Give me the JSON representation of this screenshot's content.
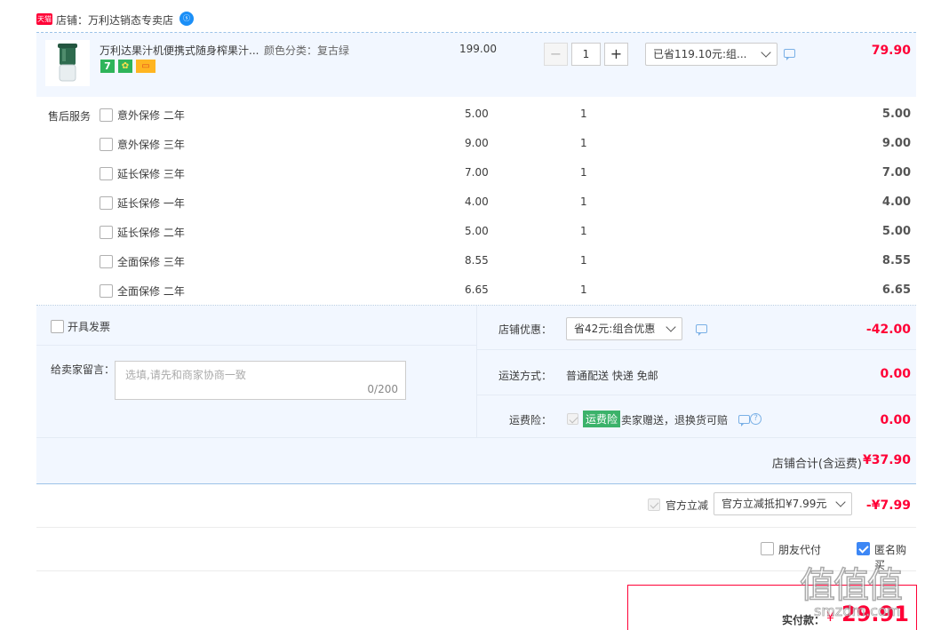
{
  "shop": {
    "badge": "天猫",
    "label": "店铺：",
    "name": "万利达销态专卖店",
    "chat_badge": "ⓢ"
  },
  "product": {
    "name": "万利达果汁机便携式随身榨果汁...",
    "color_label": "颜色分类：复古绿",
    "price": "199.00",
    "quantity": "1",
    "minus": "−",
    "plus": "+",
    "discount_select": "已省119.10元:组...",
    "total": "79.90",
    "badges": [
      "7",
      "✿",
      "▭"
    ]
  },
  "after_sales": {
    "label": "售后服务",
    "items": [
      {
        "name": "意外保修 二年",
        "price": "5.00",
        "qty": "1",
        "total": "5.00"
      },
      {
        "name": "意外保修 三年",
        "price": "9.00",
        "qty": "1",
        "total": "9.00"
      },
      {
        "name": "延长保修 三年",
        "price": "7.00",
        "qty": "1",
        "total": "7.00"
      },
      {
        "name": "延长保修 一年",
        "price": "4.00",
        "qty": "1",
        "total": "4.00"
      },
      {
        "name": "延长保修 二年",
        "price": "5.00",
        "qty": "1",
        "total": "5.00"
      },
      {
        "name": "全面保修 三年",
        "price": "8.55",
        "qty": "1",
        "total": "8.55"
      },
      {
        "name": "全面保修 二年",
        "price": "6.65",
        "qty": "1",
        "total": "6.65"
      }
    ]
  },
  "invoice": {
    "label": "开具发票"
  },
  "message": {
    "label": "给卖家留言：",
    "placeholder": "选填,请先和商家协商一致",
    "counter": "0/200"
  },
  "shop_discount": {
    "label": "店铺优惠：",
    "select": "省42元:组合优惠",
    "amount": "-42.00"
  },
  "shipping": {
    "label": "运送方式：",
    "value": "普通配送 快递 免邮",
    "amount": "0.00"
  },
  "insurance": {
    "label": "运费险：",
    "tag": "运费险",
    "text": "卖家赠送，退换货可赔",
    "amount": "0.00",
    "help": "?"
  },
  "shop_total": {
    "label": "店铺合计(含运费)",
    "amount": "¥37.90"
  },
  "official": {
    "label": "官方立减",
    "select": "官方立减抵扣¥7.99元",
    "amount": "-¥7.99"
  },
  "options": {
    "friend_pay": "朋友代付",
    "anonymous": "匿名购买"
  },
  "payable": {
    "label": "实付款：",
    "currency": "¥",
    "amount": "29.91"
  },
  "watermark": {
    "text": "值值值",
    "sub": "smzdm.com"
  },
  "colors": {
    "accent": "#ff0036",
    "panel": "#f2f7ff",
    "product_bg": "#f2f7ff",
    "tmall_red": "#ff0036",
    "check_blue": "#3d87f5",
    "tag_green": "#3bb26a"
  }
}
